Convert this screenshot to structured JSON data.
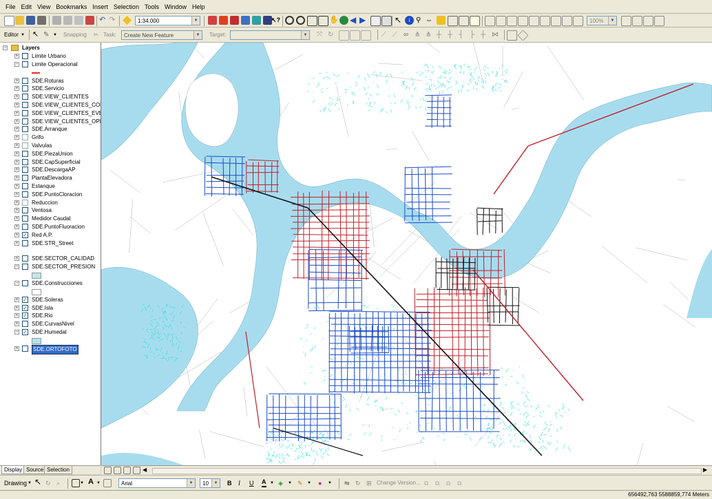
{
  "menubar": {
    "items": [
      "File",
      "Edit",
      "View",
      "Bookmarks",
      "Insert",
      "Selection",
      "Tools",
      "Window",
      "Help"
    ]
  },
  "toolbar": {
    "scale": "1:34.000",
    "zoom_percent": "100%"
  },
  "editor": {
    "label": "Editor",
    "snapping": "Snapping",
    "task_label": "Task:",
    "task_value": "Create New Feature",
    "target_label": "Target:",
    "target_value": ""
  },
  "toc": {
    "root": "Layers",
    "layers": [
      {
        "name": "Limite Urbano",
        "checked": false,
        "expanded": false
      },
      {
        "name": "Limite Operacional",
        "checked": false,
        "expanded": true,
        "symbol": "#e0301e"
      },
      {
        "name": "SDE.Roturas",
        "checked": false,
        "expanded": false
      },
      {
        "name": "SDE.Servicio",
        "checked": false,
        "expanded": false
      },
      {
        "name": "SDE.VIEW_CLIENTES",
        "checked": false,
        "expanded": false
      },
      {
        "name": "SDE.VIEW_CLIENTES_CONSU",
        "checked": false,
        "expanded": false
      },
      {
        "name": "SDE.VIEW_CLIENTES_EVENT",
        "checked": false,
        "expanded": false
      },
      {
        "name": "SDE.VIEW_CLIENTES_OPERA",
        "checked": false,
        "expanded": false
      },
      {
        "name": "SDE.Arranque",
        "checked": false,
        "expanded": false
      },
      {
        "name": "Grifo",
        "checked": false,
        "expanded": false,
        "dim": true
      },
      {
        "name": "Valvulas",
        "checked": false,
        "expanded": false,
        "dim": true
      },
      {
        "name": "SDE.PiezaUnion",
        "checked": false,
        "expanded": false
      },
      {
        "name": "SDE.CapSuperficial",
        "checked": false,
        "expanded": false
      },
      {
        "name": "SDE.DescargaAP",
        "checked": false,
        "expanded": false
      },
      {
        "name": "PlantaElevadora",
        "checked": false,
        "expanded": false
      },
      {
        "name": "Estanque",
        "checked": false,
        "expanded": false
      },
      {
        "name": "SDE.PuntoCloracion",
        "checked": false,
        "expanded": false
      },
      {
        "name": "Reduccion",
        "checked": false,
        "expanded": false,
        "dim": true
      },
      {
        "name": "Ventosa",
        "checked": false,
        "expanded": false
      },
      {
        "name": "Medidor Caudal",
        "checked": false,
        "expanded": false
      },
      {
        "name": "SDE.PuntoFluoracion",
        "checked": false,
        "expanded": false
      },
      {
        "name": "Red A.P.",
        "checked": true,
        "expanded": false
      },
      {
        "name": "SDE.STR_Street",
        "checked": false,
        "expanded": false
      },
      {
        "name": "SDE.SECTOR_CALIDAD",
        "checked": false,
        "expanded": false,
        "gapBefore": true
      },
      {
        "name": "SDE.SECTOR_PRESION",
        "checked": false,
        "expanded": true,
        "symbol": "#bfe6ee"
      },
      {
        "name": "SDE.Construcciones",
        "checked": false,
        "expanded": true,
        "symbol": "#ffffff"
      },
      {
        "name": "SDE.Soleras",
        "checked": true,
        "expanded": false
      },
      {
        "name": "SDE.Isla",
        "checked": true,
        "expanded": false
      },
      {
        "name": "SDE.Rio",
        "checked": true,
        "expanded": false
      },
      {
        "name": "SDE.CurvasNivel",
        "checked": false,
        "expanded": false
      },
      {
        "name": "SDE.Humedal",
        "checked": true,
        "expanded": true,
        "symbol": "#aee6ea"
      },
      {
        "name": "SDE.ORTOFOTO",
        "checked": false,
        "expanded": false,
        "selected": true
      }
    ]
  },
  "tabs": [
    "Display",
    "Source",
    "Selection"
  ],
  "drawing": {
    "label": "Drawing",
    "font": "Arial",
    "size": "10",
    "bold": "B",
    "italic": "I",
    "underline": "U",
    "change_version": "Change Version..."
  },
  "status": {
    "coords": "656492,763  5588859,774 Meters"
  },
  "map": {
    "colors": {
      "river": "#a7dcee",
      "wetland": "#30e0d8",
      "red_network": "#c0202a",
      "blue_network": "#1c4bc4",
      "black_network": "#111111",
      "roads": "#b0b0b0"
    }
  }
}
